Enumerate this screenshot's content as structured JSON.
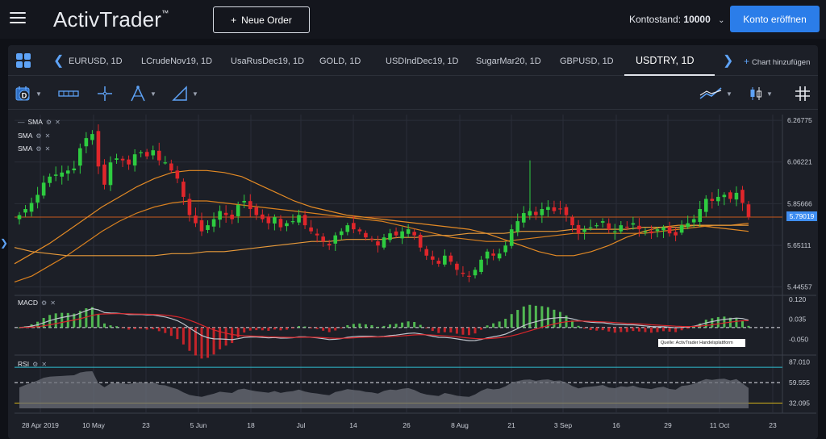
{
  "app": {
    "logo": "ActivTrader",
    "logo_mark": "™",
    "new_order": "Neue Order",
    "balance_label": "Kontostand:",
    "balance_value": "10000",
    "open_account": "Konto eröffnen"
  },
  "tabs": [
    {
      "label": "EURUSD, 1D"
    },
    {
      "label": "LCrudeNov19, 1D"
    },
    {
      "label": "UsaRusDec19, 1D"
    },
    {
      "label": "GOLD, 1D"
    },
    {
      "label": "USDIndDec19, 1D"
    },
    {
      "label": "SugarMar20, 1D"
    },
    {
      "label": "GBPUSD, 1D"
    },
    {
      "label": "USDTRY, 1D"
    }
  ],
  "add_chart": "Chart hinzufügen",
  "toolbar_icons": [
    "calendar-d-icon",
    "chart-type-icon",
    "crosshair-icon",
    "fibonacci-icon",
    "drawing-icon",
    "indicators-icon",
    "candle-style-icon",
    "grid-icon"
  ],
  "indicators": {
    "sma1": "SMA",
    "sma2": "SMA",
    "sma3": "SMA",
    "macd": "MACD",
    "rsi": "RSI"
  },
  "current_price": "5.79019",
  "source_note": "Quelle: ActivTrader Handelsplattform",
  "colors": {
    "accent": "#2b7de9",
    "bull": "#2ecc40",
    "bear": "#e0262b",
    "sma": "#e38a25",
    "rsi_fill": "#4fd6e8"
  },
  "chart_data": {
    "type": "candlestick",
    "symbol": "USDTRY",
    "timeframe": "1D",
    "y_ticks": [
      "6.26775",
      "6.06221",
      "5.85666",
      "5.65111",
      "5.44557"
    ],
    "x_ticks": [
      "28 Apr 2019",
      "10 May",
      "23",
      "5 Jun",
      "18",
      "Jul",
      "14",
      "26",
      "8 Aug",
      "21",
      "3 Sep",
      "16",
      "29",
      "11 Oct",
      "23"
    ],
    "ylim": [
      5.42,
      6.28
    ],
    "last_price": 5.79019,
    "close_series": [
      5.8,
      5.83,
      5.86,
      5.9,
      5.96,
      5.99,
      6.0,
      6.01,
      6.02,
      6.03,
      6.13,
      6.18,
      6.2,
      6.04,
      5.95,
      6.06,
      6.08,
      6.07,
      6.05,
      6.1,
      6.11,
      6.09,
      6.12,
      6.07,
      6.06,
      6.02,
      5.98,
      5.89,
      5.8,
      5.76,
      5.72,
      5.75,
      5.78,
      5.82,
      5.8,
      5.78,
      5.85,
      5.87,
      5.83,
      5.8,
      5.78,
      5.76,
      5.79,
      5.74,
      5.76,
      5.77,
      5.8,
      5.75,
      5.72,
      5.7,
      5.67,
      5.65,
      5.7,
      5.72,
      5.75,
      5.73,
      5.72,
      5.69,
      5.68,
      5.65,
      5.69,
      5.71,
      5.7,
      5.72,
      5.73,
      5.7,
      5.64,
      5.6,
      5.58,
      5.56,
      5.6,
      5.57,
      5.53,
      5.51,
      5.5,
      5.53,
      5.58,
      5.62,
      5.6,
      5.61,
      5.65,
      5.73,
      5.77,
      5.81,
      5.82,
      5.8,
      5.83,
      5.84,
      5.82,
      5.83,
      5.8,
      5.75,
      5.71,
      5.73,
      5.74,
      5.75,
      5.77,
      5.73,
      5.72,
      5.75,
      5.74,
      5.76,
      5.73,
      5.72,
      5.71,
      5.73,
      5.74,
      5.71,
      5.7,
      5.75,
      5.76,
      5.78,
      5.83,
      5.88,
      5.87,
      5.89,
      5.9,
      5.88,
      5.91,
      5.86,
      5.79
    ],
    "sma_series": [
      {
        "name": "SMA 1",
        "values": [
          5.56,
          5.61,
          5.66,
          5.72,
          5.78,
          5.84,
          5.89,
          5.94,
          5.98,
          6.01,
          6.02,
          6.02,
          6.01,
          5.99,
          5.95,
          5.91,
          5.87,
          5.84,
          5.82,
          5.8,
          5.79,
          5.78,
          5.77,
          5.76,
          5.75,
          5.74,
          5.73,
          5.71,
          5.68,
          5.65,
          5.62,
          5.6,
          5.6,
          5.62,
          5.65,
          5.69,
          5.72,
          5.74,
          5.75,
          5.75,
          5.74,
          5.73,
          5.72
        ]
      },
      {
        "name": "SMA 2",
        "values": [
          5.47,
          5.5,
          5.55,
          5.6,
          5.66,
          5.72,
          5.77,
          5.81,
          5.84,
          5.86,
          5.87,
          5.87,
          5.86,
          5.85,
          5.84,
          5.83,
          5.82,
          5.81,
          5.8,
          5.79,
          5.78,
          5.77,
          5.75,
          5.73,
          5.71,
          5.69,
          5.68,
          5.67,
          5.67,
          5.68,
          5.69,
          5.7,
          5.71,
          5.71,
          5.71,
          5.71,
          5.71,
          5.72,
          5.73,
          5.74,
          5.75,
          5.75,
          5.76
        ]
      },
      {
        "name": "SMA 3",
        "values": [
          5.64,
          5.62,
          5.61,
          5.6,
          5.6,
          5.6,
          5.6,
          5.6,
          5.6,
          5.61,
          5.61,
          5.62,
          5.62,
          5.63,
          5.64,
          5.65,
          5.66,
          5.67,
          5.67,
          5.68,
          5.68,
          5.68,
          5.69,
          5.69,
          5.7,
          5.7,
          5.71,
          5.71,
          5.71,
          5.72,
          5.72,
          5.72,
          5.73,
          5.73,
          5.73,
          5.73,
          5.74,
          5.74,
          5.74,
          5.75,
          5.75,
          5.75,
          5.75
        ]
      }
    ],
    "macd": {
      "y_ticks": [
        "0.120",
        "0.035",
        "-0.050"
      ],
      "ylim": [
        -0.09,
        0.13
      ]
    },
    "rsi": {
      "y_ticks": [
        "87.010",
        "59.555",
        "32.095"
      ],
      "ylim": [
        25,
        92
      ]
    },
    "grid": true
  }
}
